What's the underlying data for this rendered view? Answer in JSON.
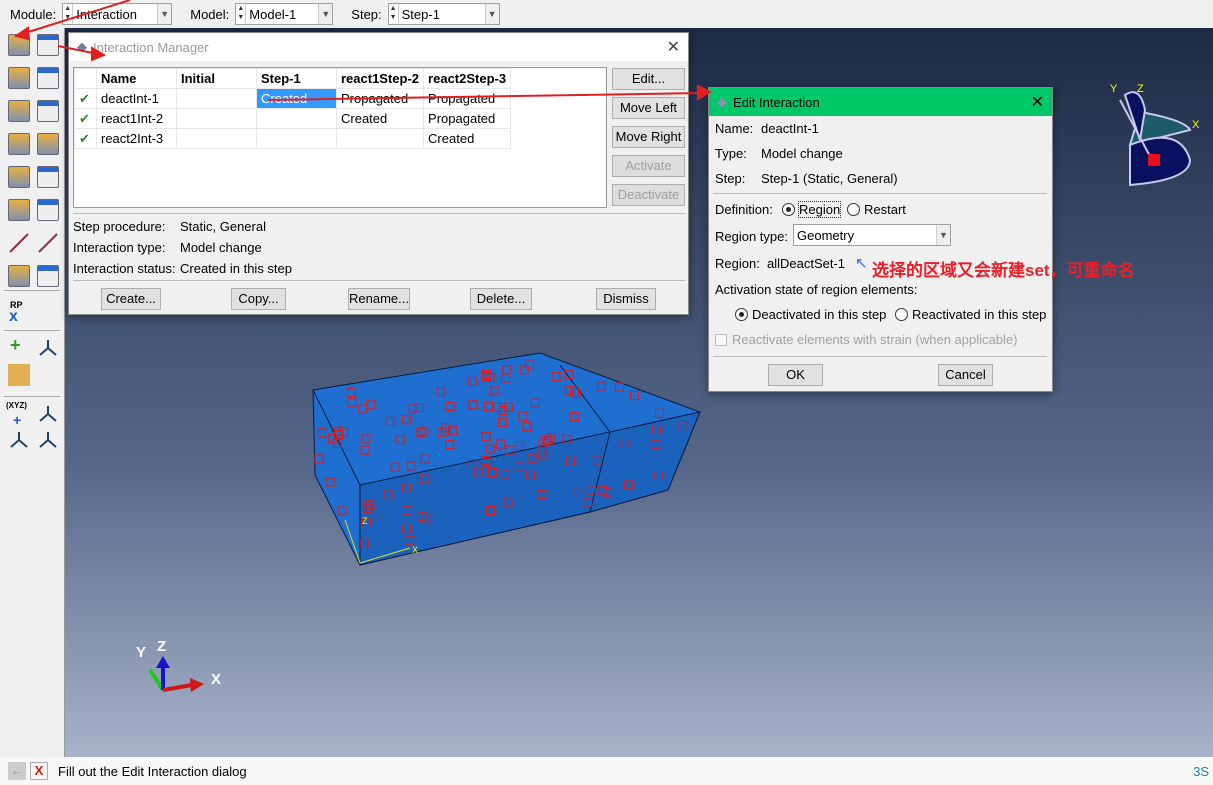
{
  "topbar": {
    "module_label": "Module:",
    "module_value": "Interaction",
    "model_label": "Model:",
    "model_value": "Model-1",
    "step_label": "Step:",
    "step_value": "Step-1"
  },
  "toolbox": {
    "rp_label": "RP",
    "xyz_label": "(XYZ)"
  },
  "manager": {
    "title": "Interaction Manager",
    "columns": [
      "Name",
      "Initial",
      "Step-1",
      "react1Step-2",
      "react2Step-3"
    ],
    "rows": [
      {
        "name": "deactInt-1",
        "initial": "",
        "step1": "Created",
        "step2": "Propagated",
        "step3": "Propagated"
      },
      {
        "name": "react1Int-2",
        "initial": "",
        "step1": "",
        "step2": "Created",
        "step3": "Propagated"
      },
      {
        "name": "react2Int-3",
        "initial": "",
        "step1": "",
        "step2": "",
        "step3": "Created"
      }
    ],
    "side_buttons": {
      "edit": "Edit...",
      "move_left": "Move Left",
      "move_right": "Move Right",
      "activate": "Activate",
      "deactivate": "Deactivate"
    },
    "info": {
      "procedure_label": "Step procedure:",
      "procedure_value": "Static, General",
      "type_label": "Interaction type:",
      "type_value": "Model change",
      "status_label": "Interaction status:",
      "status_value": "Created in this step"
    },
    "bottom_buttons": {
      "create": "Create...",
      "copy": "Copy...",
      "rename": "Rename...",
      "delete": "Delete...",
      "dismiss": "Dismiss"
    }
  },
  "edit": {
    "title": "Edit Interaction",
    "title_color": "#00c868",
    "name_label": "Name:",
    "name_value": "deactInt-1",
    "type_label": "Type:",
    "type_value": "Model change",
    "step_label": "Step:",
    "step_value": "Step-1 (Static, General)",
    "definition_label": "Definition:",
    "definition_options": [
      "Region",
      "Restart"
    ],
    "definition_selected": "Region",
    "region_type_label": "Region type:",
    "region_type_value": "Geometry",
    "region_label": "Region:",
    "region_value": "allDeactSet-1",
    "activation_label": "Activation state of region elements:",
    "activation_options": [
      "Deactivated in this step",
      "Reactivated in this step"
    ],
    "activation_selected": "Deactivated in this step",
    "strain_checkbox": "Reactivate elements with strain (when applicable)",
    "strain_checked": false,
    "ok": "OK",
    "cancel": "Cancel"
  },
  "annotation": {
    "text": "选择的区域又会新建set，可重命名",
    "color": "#e8202a"
  },
  "triad": {
    "x": "X",
    "y": "Y",
    "z": "Z"
  },
  "status": {
    "message": "Fill out the Edit Interaction dialog"
  }
}
